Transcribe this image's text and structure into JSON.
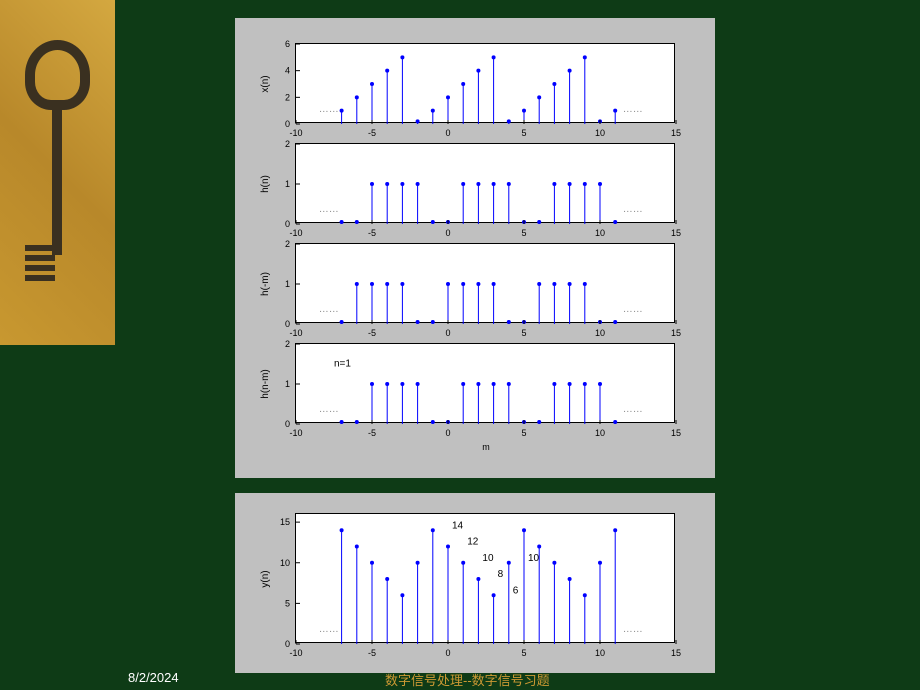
{
  "footer": {
    "date": "8/2/2024",
    "title": "数字信号处理--数字信号习题"
  },
  "chart_data": [
    {
      "type": "stem",
      "id": "xn",
      "ylabel": "x(n)",
      "xlim": [
        -10,
        15
      ],
      "ylim": [
        0,
        6
      ],
      "yticks": [
        0,
        2,
        4,
        6
      ],
      "xticks": [
        -10,
        -5,
        0,
        5,
        10,
        15
      ],
      "annotation": "",
      "ellipses": true,
      "x": [
        -7,
        -6,
        -5,
        -4,
        -3,
        -2,
        -1,
        0,
        1,
        2,
        3,
        4,
        5,
        6,
        7,
        8,
        9,
        10,
        11
      ],
      "values": [
        1,
        2,
        3,
        4,
        5,
        0.2,
        1,
        2,
        3,
        4,
        5,
        0.2,
        1,
        2,
        3,
        4,
        5,
        0.2,
        1
      ]
    },
    {
      "type": "stem",
      "id": "hn",
      "ylabel": "h(n)",
      "xlim": [
        -10,
        15
      ],
      "ylim": [
        0,
        2
      ],
      "yticks": [
        0,
        1,
        2
      ],
      "xticks": [
        -10,
        -5,
        0,
        5,
        10,
        15
      ],
      "annotation": "",
      "ellipses": true,
      "x": [
        -7,
        -6,
        -5,
        -4,
        -3,
        -2,
        -1,
        0,
        1,
        2,
        3,
        4,
        5,
        6,
        7,
        8,
        9,
        10,
        11
      ],
      "values": [
        0.05,
        0.05,
        1,
        1,
        1,
        1,
        0.05,
        0.05,
        1,
        1,
        1,
        1,
        0.05,
        0.05,
        1,
        1,
        1,
        1,
        0.05
      ]
    },
    {
      "type": "stem",
      "id": "hminusm",
      "ylabel": "h(-m)",
      "xlim": [
        -10,
        15
      ],
      "ylim": [
        0,
        2
      ],
      "yticks": [
        0,
        1,
        2
      ],
      "xticks": [
        -10,
        -5,
        0,
        5,
        10,
        15
      ],
      "annotation": "",
      "ellipses": true,
      "x": [
        -7,
        -6,
        -5,
        -4,
        -3,
        -2,
        -1,
        0,
        1,
        2,
        3,
        4,
        5,
        6,
        7,
        8,
        9,
        10,
        11
      ],
      "values": [
        0.05,
        1,
        1,
        1,
        1,
        0.05,
        0.05,
        1,
        1,
        1,
        1,
        0.05,
        0.05,
        1,
        1,
        1,
        1,
        0.05,
        0.05
      ]
    },
    {
      "type": "stem",
      "id": "hnminusm",
      "ylabel": "h(n-m)",
      "xlim": [
        -10,
        15
      ],
      "ylim": [
        0,
        2
      ],
      "yticks": [
        0,
        1,
        2
      ],
      "xticks": [
        -10,
        -5,
        0,
        5,
        10,
        15
      ],
      "xlabel": "m",
      "annotation": "n=1",
      "ellipses": true,
      "x": [
        -7,
        -6,
        -5,
        -4,
        -3,
        -2,
        -1,
        0,
        1,
        2,
        3,
        4,
        5,
        6,
        7,
        8,
        9,
        10,
        11
      ],
      "values": [
        0.05,
        0.05,
        1,
        1,
        1,
        1,
        0.05,
        0.05,
        1,
        1,
        1,
        1,
        0.05,
        0.05,
        1,
        1,
        1,
        1,
        0.05
      ]
    },
    {
      "type": "stem",
      "id": "yn",
      "ylabel": "y(n)",
      "xlim": [
        -10,
        15
      ],
      "ylim": [
        0,
        16
      ],
      "yticks": [
        0,
        5,
        10,
        15
      ],
      "xticks": [
        -10,
        -5,
        0,
        5,
        10,
        15
      ],
      "annotation": "",
      "ellipses": true,
      "x": [
        -7,
        -6,
        -5,
        -4,
        -3,
        -2,
        -1,
        0,
        1,
        2,
        3,
        4,
        5,
        6,
        7,
        8,
        9,
        10,
        11
      ],
      "values": [
        14,
        12,
        10,
        8,
        6,
        10,
        14,
        12,
        10,
        8,
        6,
        10,
        14,
        12,
        10,
        8,
        6,
        10,
        14
      ],
      "data_labels": [
        {
          "x": 0,
          "y": 14,
          "text": "14"
        },
        {
          "x": 1,
          "y": 12,
          "text": "12"
        },
        {
          "x": 2,
          "y": 10,
          "text": "10"
        },
        {
          "x": 3,
          "y": 8,
          "text": "8"
        },
        {
          "x": 4,
          "y": 6,
          "text": "6"
        },
        {
          "x": 5,
          "y": 10,
          "text": "10"
        }
      ]
    }
  ]
}
